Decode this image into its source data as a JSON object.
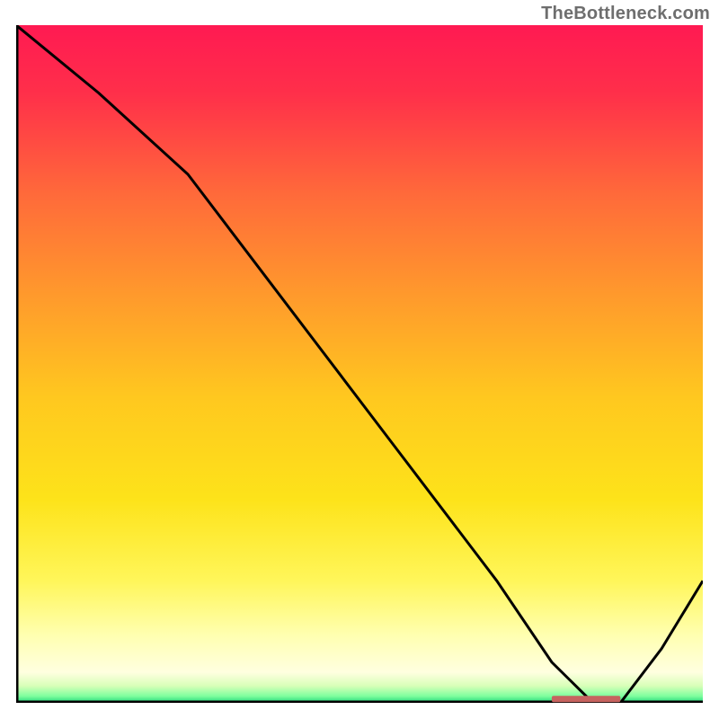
{
  "watermark": "TheBottleneck.com",
  "chart_data": {
    "type": "line",
    "title": "",
    "xlabel": "",
    "ylabel": "",
    "xlim": [
      0,
      100
    ],
    "ylim": [
      0,
      100
    ],
    "series": [
      {
        "name": "curve",
        "x": [
          0,
          12,
          25,
          40,
          55,
          70,
          78,
          84,
          88,
          94,
          100
        ],
        "y": [
          100,
          90,
          78,
          58,
          38,
          18,
          6,
          0,
          0,
          8,
          18
        ]
      }
    ],
    "optimum_band": {
      "x_start": 78,
      "x_end": 88,
      "y": 0.5
    },
    "gradient_stops": [
      {
        "offset": 0.0,
        "color": "#ff1a52"
      },
      {
        "offset": 0.1,
        "color": "#ff2f4a"
      },
      {
        "offset": 0.25,
        "color": "#ff6a3a"
      },
      {
        "offset": 0.4,
        "color": "#ff9a2c"
      },
      {
        "offset": 0.55,
        "color": "#ffc81f"
      },
      {
        "offset": 0.7,
        "color": "#fde31a"
      },
      {
        "offset": 0.82,
        "color": "#fff65a"
      },
      {
        "offset": 0.9,
        "color": "#ffffb0"
      },
      {
        "offset": 0.955,
        "color": "#ffffe0"
      },
      {
        "offset": 0.975,
        "color": "#d8ffb8"
      },
      {
        "offset": 0.99,
        "color": "#7fff9e"
      },
      {
        "offset": 1.0,
        "color": "#1fd67a"
      }
    ],
    "colors": {
      "line": "#000000",
      "axis": "#000000",
      "optimum_marker": "#c6635f"
    }
  }
}
